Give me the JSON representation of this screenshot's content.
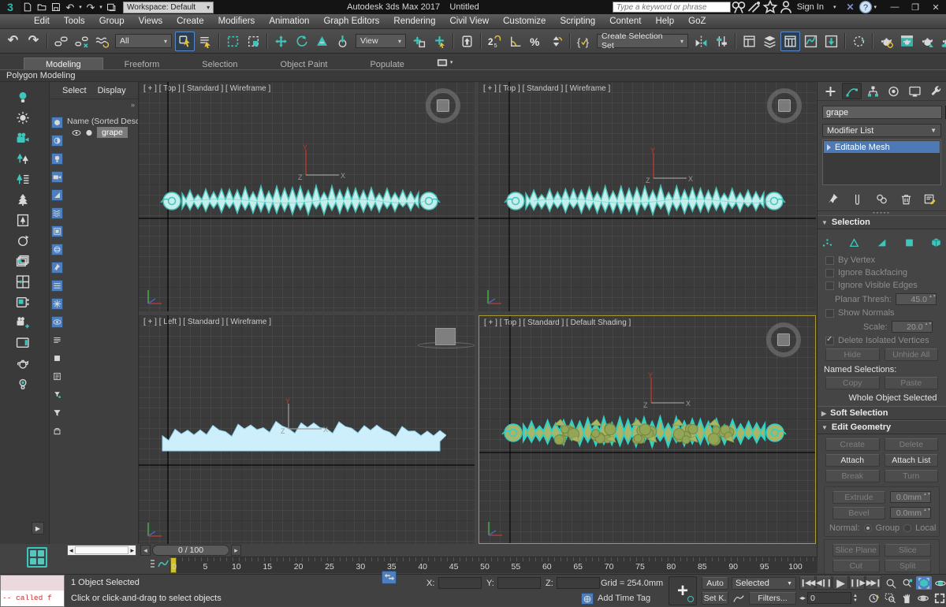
{
  "window": {
    "app_title": "Autodesk 3ds Max 2017",
    "doc_title": "Untitled",
    "workspace": "Workspace: Default",
    "search_placeholder": "Type a keyword or phrase",
    "sign_in": "Sign In"
  },
  "menus": [
    "Edit",
    "Tools",
    "Group",
    "Views",
    "Create",
    "Modifiers",
    "Animation",
    "Graph Editors",
    "Rendering",
    "Civil View",
    "Customize",
    "Scripting",
    "Content",
    "Help",
    "GoZ"
  ],
  "toolbar": {
    "selection_filter": "All",
    "coord_system": "View",
    "selection_set": "Create Selection Set",
    "group1": [
      "undo",
      "redo",
      "|",
      "link",
      "unlink",
      "bind"
    ],
    "group2": [
      "select*",
      "select-by-name",
      "|",
      "region",
      "window-crossing",
      "|",
      "move",
      "rotate",
      "scale",
      "place"
    ],
    "group3": [
      "pivot",
      "manipulate",
      "|",
      "keyboard",
      "|",
      "snap25",
      "snap-angle",
      "snap-percent",
      "snap-spinner",
      "|",
      "named-sets"
    ],
    "group4": [
      "mirror",
      "align",
      "|",
      "scene-explorer",
      "layer-explorer",
      "ribbon*",
      "curve-editor",
      "schematic",
      "|",
      "mxs",
      "|",
      "render-setup",
      "rendered-frame",
      "render",
      "render-cloud",
      "a360"
    ]
  },
  "ribbon": {
    "tabs": [
      "Modeling",
      "Freeform",
      "Selection",
      "Object Paint",
      "Populate"
    ],
    "active": "Modeling",
    "panel": "Polygon Modeling"
  },
  "left_toolbar": [
    "bulb",
    "sun",
    "camera",
    "trees",
    "tree-list",
    "tree",
    "tree-card",
    "ring",
    "layers",
    "quad",
    "video",
    "camera-plus",
    "monitor",
    "teapot",
    "bulb-gear"
  ],
  "scene_explorer": {
    "select_menu": "Select",
    "display_menu": "Display",
    "column_header": "Name (Sorted Descen",
    "item": "grape",
    "filters": [
      "dot",
      "half",
      "bulb-f",
      "cam",
      "tri",
      "waves",
      "chip",
      "sphere",
      "pin",
      "bars",
      "flake",
      "eye"
    ],
    "filters_gray": [
      "list",
      "square",
      "note",
      "funnel-dot",
      "funnel",
      "bag"
    ]
  },
  "viewports": [
    {
      "label": "[ + ] [ Top ] [ Standard ] [ Wireframe ]"
    },
    {
      "label": "[ + ] [ Top ] [ Standard ] [ Wireframe ]"
    },
    {
      "label": "[ + ] [ Left ] [ Standard ] [ Wireframe ]"
    },
    {
      "label": "[ + ] [ Top ] [ Standard ] [ Default Shading ]"
    }
  ],
  "command_panel": {
    "tabs": [
      "create",
      "modify*",
      "hierarchy",
      "motion",
      "display",
      "utilities"
    ],
    "object_name": "grape",
    "modifier_list": "Modifier List",
    "stack_item": "Editable Mesh",
    "stack_buttons": [
      "pin",
      "endresult",
      "unique",
      "trash",
      "config"
    ],
    "selection": {
      "title": "Selection",
      "subobject": [
        "vertex",
        "edge",
        "face",
        "poly",
        "element"
      ],
      "by_vertex": "By Vertex",
      "ignore_backfacing": "Ignore Backfacing",
      "ignore_visible_edges": "Ignore Visible Edges",
      "planar_label": "Planar Thresh:",
      "planar_value": "45.0",
      "show_normals": "Show Normals",
      "scale_label": "Scale:",
      "scale_value": "20.0",
      "delete_isolated": "Delete Isolated Vertices",
      "hide": "Hide",
      "unhide_all": "Unhide All",
      "named_selections": "Named Selections:",
      "copy": "Copy",
      "paste": "Paste",
      "status": "Whole Object Selected"
    },
    "soft_selection": "Soft Selection",
    "edit_geometry": {
      "title": "Edit Geometry",
      "create": "Create",
      "del": "Delete",
      "attach": "Attach",
      "attach_list": "Attach List",
      "brk": "Break",
      "turn": "Turn",
      "extrude": "Extrude",
      "extrude_value": "0.0mm",
      "bevel": "Bevel",
      "bevel_value": "0.0mm",
      "normal": "Normal:",
      "group": "Group",
      "local": "Local",
      "slice_plane": "Slice Plane",
      "slice": "Slice",
      "cut": "Cut",
      "split": "Split"
    }
  },
  "timeline": {
    "value": "0 / 100",
    "ticks": [
      "0",
      "5",
      "10",
      "15",
      "20",
      "25",
      "30",
      "35",
      "40",
      "45",
      "50",
      "55",
      "60",
      "65",
      "70",
      "75",
      "80",
      "85",
      "90",
      "95",
      "100"
    ]
  },
  "statusbar": {
    "listener": "-- called f",
    "selected": "1 Object Selected",
    "prompt": "Click or click-and-drag to select objects",
    "x": "X:",
    "y": "Y:",
    "z": "Z:",
    "grid": "Grid = 254.0mm",
    "add_time_tag": "Add Time Tag",
    "auto": "Auto",
    "set_key": "Set K.",
    "selected_filter": "Selected",
    "filters": "Filters...",
    "frame": "0",
    "row1_icons": [
      "brackets",
      "lock",
      "xform*"
    ],
    "playback": [
      "first",
      "prevkey",
      "play",
      "nextkey",
      "last"
    ],
    "nav1": [
      "zoom",
      "zoom-all",
      "zoom-ext*",
      "orbit-sel"
    ],
    "nav2": [
      "clock",
      "regionzoom",
      "pan",
      "orbit",
      "maxi"
    ]
  },
  "colors": {
    "accent_teal": "#3ec6bc",
    "highlight_blue": "#4d7fbe",
    "stack_selected": "#4d7ab5",
    "swatch_yellow": "#d8b626",
    "active_viewport_border": "#a99b2f",
    "frame_marker_yellow": "#cfc12d"
  }
}
